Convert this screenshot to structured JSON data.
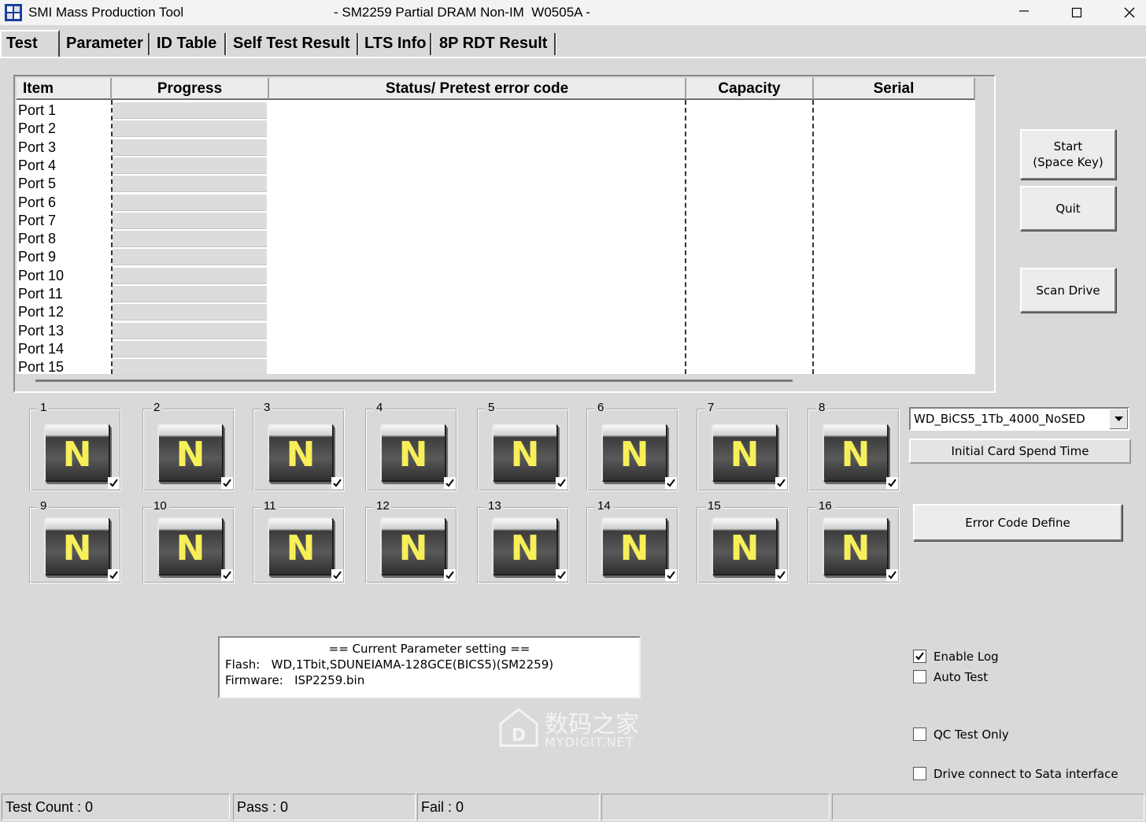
{
  "window": {
    "app_title": "SMI Mass Production Tool",
    "doc_title": "- SM2259 Partial DRAM Non-IM  W0505A -",
    "app_icon": "smi-app-icon",
    "controls": [
      "minimize-icon",
      "maximize-icon",
      "close-icon"
    ]
  },
  "tabs": [
    "Test",
    "Parameter",
    "ID Table",
    "Self Test Result",
    "LTS Info",
    "8P RDT Result"
  ],
  "active_tab": "Test",
  "table": {
    "columns": [
      "Item",
      "Progress",
      "Status/ Pretest error code",
      "Capacity",
      "Serial"
    ],
    "rows": [
      "Port 1",
      "Port 2",
      "Port 3",
      "Port 4",
      "Port 5",
      "Port 6",
      "Port 7",
      "Port 8",
      "Port 9",
      "Port 10",
      "Port 11",
      "Port 12",
      "Port 13",
      "Port 14",
      "Port 15"
    ]
  },
  "buttons": {
    "start_line1": "Start",
    "start_line2": "(Space Key)",
    "quit": "Quit",
    "scan_drive": "Scan Drive",
    "error_code_define": "Error Code Define"
  },
  "ports": [
    {
      "num": "1",
      "status": "N"
    },
    {
      "num": "2",
      "status": "N"
    },
    {
      "num": "3",
      "status": "N"
    },
    {
      "num": "4",
      "status": "N"
    },
    {
      "num": "5",
      "status": "N"
    },
    {
      "num": "6",
      "status": "N"
    },
    {
      "num": "7",
      "status": "N"
    },
    {
      "num": "8",
      "status": "N"
    },
    {
      "num": "9",
      "status": "N"
    },
    {
      "num": "10",
      "status": "N"
    },
    {
      "num": "11",
      "status": "N"
    },
    {
      "num": "12",
      "status": "N"
    },
    {
      "num": "13",
      "status": "N"
    },
    {
      "num": "14",
      "status": "N"
    },
    {
      "num": "15",
      "status": "N"
    },
    {
      "num": "16",
      "status": "N"
    }
  ],
  "flash_select": "WD_BiCS5_1Tb_4000_NoSED",
  "initial_card_label": "Initial Card Spend Time",
  "params": {
    "header": "== Current Parameter setting ==",
    "flash": "Flash:   WD,1Tbit,SDUNEIAMA-128GCE(BICS5)(SM2259)",
    "firmware": "Firmware:   ISP2259.bin"
  },
  "options": [
    {
      "label": "Enable Log",
      "checked": true
    },
    {
      "label": "Auto Test",
      "checked": false
    },
    {
      "label": "QC Test Only",
      "checked": false
    },
    {
      "label": "Drive connect to Sata interface",
      "checked": false
    }
  ],
  "watermark": {
    "line1": "数码之家",
    "line2": "MYDIGIT.NET"
  },
  "status": {
    "test_count": "Test Count : 0",
    "pass": "Pass : 0",
    "fail": "Fail : 0",
    "cell4": "",
    "cell5": ""
  },
  "colors": {
    "window_bg": "#d9d9d9",
    "n_letter": "#f6ef5a"
  }
}
